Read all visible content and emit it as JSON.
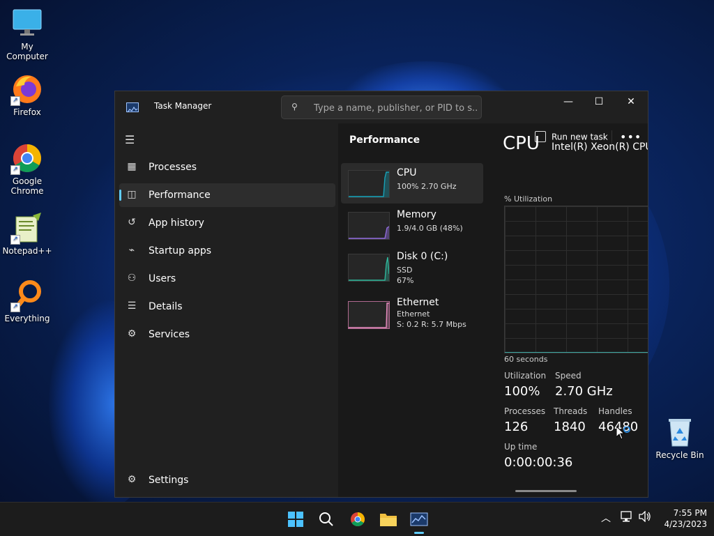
{
  "desktop": {
    "icons": [
      {
        "label": "My Computer",
        "icon": "monitor-icon"
      },
      {
        "label": "Firefox",
        "icon": "firefox-icon"
      },
      {
        "label": "Google Chrome",
        "icon": "chrome-icon"
      },
      {
        "label": "Notepad++",
        "icon": "notepad-plus-plus-icon"
      },
      {
        "label": "Everything",
        "icon": "magnifier-icon"
      },
      {
        "label": "Recycle Bin",
        "icon": "recycle-bin-icon"
      }
    ]
  },
  "window": {
    "title": "Task Manager",
    "search_placeholder": "Type a name, publisher, or PID to s...",
    "controls": {
      "minimize": "—",
      "maximize": "☐",
      "close": "✕"
    }
  },
  "sidebar": {
    "items": [
      {
        "label": "Processes",
        "icon": "processes-icon",
        "active": false
      },
      {
        "label": "Performance",
        "icon": "performance-icon",
        "active": true
      },
      {
        "label": "App history",
        "icon": "app-history-icon",
        "active": false
      },
      {
        "label": "Startup apps",
        "icon": "startup-apps-icon",
        "active": false
      },
      {
        "label": "Users",
        "icon": "users-icon",
        "active": false
      },
      {
        "label": "Details",
        "icon": "details-icon",
        "active": false
      },
      {
        "label": "Services",
        "icon": "services-icon",
        "active": false
      }
    ],
    "settings_label": "Settings"
  },
  "main": {
    "title": "Performance",
    "run_new_task": "Run new task",
    "more": "•••",
    "resources": [
      {
        "name": "CPU",
        "line1": "100% 2.70 GHz",
        "line2": "",
        "color": "#17a2b8"
      },
      {
        "name": "Memory",
        "line1": "1.9/4.0 GB (48%)",
        "line2": "",
        "color": "#8e6ad8"
      },
      {
        "name": "Disk 0 (C:)",
        "line1": "SSD",
        "line2": "67%",
        "color": "#2fb59a"
      },
      {
        "name": "Ethernet",
        "line1": "Ethernet",
        "line2": "S: 0.2  R: 5.7 Mbps",
        "color": "#e88cc0"
      }
    ],
    "detail": {
      "heading": "CPU",
      "model": "Intel(R) Xeon(R) CPU",
      "util_label": "% Utilization",
      "time_label": "60 seconds",
      "utilization_label": "Utilization",
      "utilization_value": "100%",
      "speed_label": "Speed",
      "speed_value": "2.70 GHz",
      "processes_label": "Processes",
      "processes_value": "126",
      "threads_label": "Threads",
      "threads_value": "1840",
      "handles_label": "Handles",
      "handles_value": "46480",
      "uptime_label": "Up time",
      "uptime_value": "0:00:00:36"
    }
  },
  "taskbar": {
    "time": "7:55 PM",
    "date": "4/23/2023",
    "accent": "#60cdff"
  }
}
